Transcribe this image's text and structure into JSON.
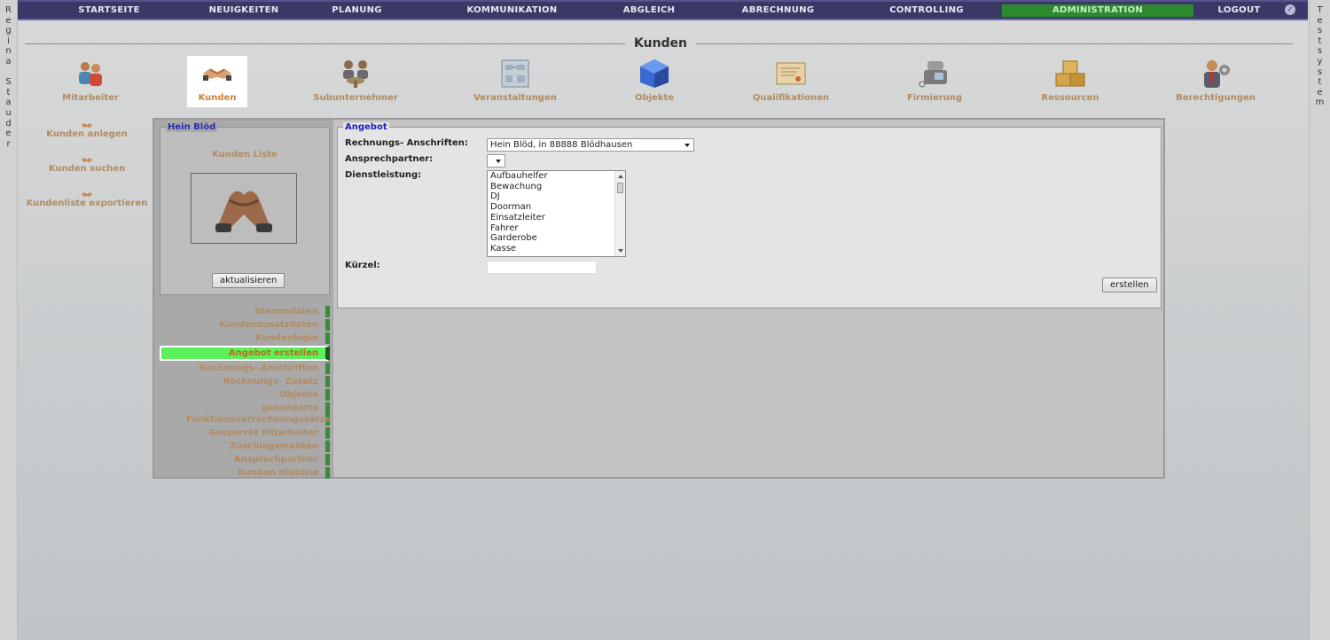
{
  "sidebar_left": {
    "letters": [
      "R",
      "e",
      "g",
      "i",
      "n",
      "a",
      "",
      "S",
      "t",
      "a",
      "u",
      "d",
      "e",
      "r"
    ]
  },
  "sidebar_right": {
    "letters": [
      "T",
      "e",
      "s",
      "t",
      "s",
      "y",
      "s",
      "t",
      "e",
      "m"
    ]
  },
  "topnav": {
    "items": [
      "STARTSEITE",
      "NEUIGKEITEN",
      "PLANUNG",
      "KOMMUNIKATION",
      "ABGLEICH",
      "ABRECHNUNG",
      "CONTROLLING",
      "ADMINISTRATION",
      "LOGOUT"
    ],
    "active": "ADMINISTRATION",
    "logo_glyph": "✓"
  },
  "page": {
    "title": "Kunden"
  },
  "modules": [
    "Mitarbeiter",
    "Kunden",
    "Subunternehmer",
    "Veranstaltungen",
    "Objekte",
    "Qualifikationen",
    "Firmierung",
    "Ressourcen",
    "Berechtigungen"
  ],
  "left_menu": [
    "Kunden anlegen",
    "Kunden suchen",
    "Kundenliste exportieren"
  ],
  "customer_box": {
    "legend": "Hein Blöd",
    "list_label": "Kunden Liste",
    "refresh_button": "aktualisieren"
  },
  "sub_nav": {
    "items": [
      "Stammdaten",
      "Kundenzusatzdaten",
      "Kundenlogin",
      "Angebot erstellen",
      "Rechnungs- Anschriften",
      "Rechnungs- Zusatz",
      "Objekte",
      "gesonderte Funktionsverrechnungssätze",
      "Gesperrte Mitarbeiter",
      "Zuschlagsmasken",
      "Ansprechpartner",
      "Kunden Historie"
    ],
    "active": "Angebot erstellen"
  },
  "form": {
    "legend": "Angebot",
    "label_rechnung": "Rechnungs- Anschriften:",
    "rechnung_value": "Hein Blöd, in 88888 Blödhausen",
    "label_ansprech": "Ansprechpartner:",
    "ansprech_value": "",
    "label_dienst": "Dienstleistung:",
    "dienst_options": [
      "Aufbauhelfer",
      "Bewachung",
      "DJ",
      "Doorman",
      "Einsatzleiter",
      "Fahrer",
      "Garderobe",
      "Kasse"
    ],
    "label_kuerzel": "Kürzel:",
    "kuerzel_value": "",
    "submit": "erstellen"
  },
  "colors": {
    "nav_bg": "#3a3866",
    "active_nav": "#2d8a2d",
    "active_sub": "#5cf05c",
    "label_brown": "#b28b62",
    "legend_blue": "#1e1ebd"
  }
}
